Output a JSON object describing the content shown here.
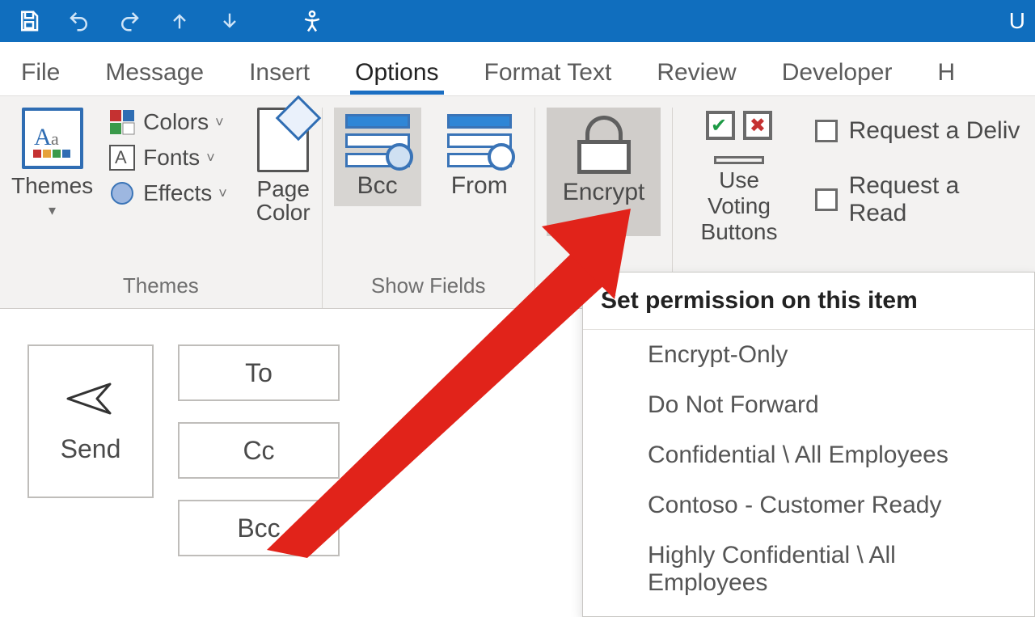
{
  "titlebar": {
    "right_text": "U"
  },
  "tabs": {
    "file": "File",
    "message": "Message",
    "insert": "Insert",
    "options": "Options",
    "format_text": "Format Text",
    "review": "Review",
    "developer": "Developer",
    "help": "H"
  },
  "ribbon": {
    "themes": {
      "themes_btn": "Themes",
      "colors": "Colors",
      "fonts": "Fonts",
      "effects": "Effects",
      "page_color": "Page\nColor",
      "group_label": "Themes"
    },
    "show_fields": {
      "bcc": "Bcc",
      "from": "From",
      "group_label": "Show Fields"
    },
    "encrypt": {
      "label": "Encrypt"
    },
    "tracking": {
      "voting": "Use Voting\nButtons",
      "req_delivery": "Request a Deliv",
      "req_read": "Request a Read"
    }
  },
  "compose": {
    "send": "Send",
    "to": "To",
    "cc": "Cc",
    "bcc": "Bcc"
  },
  "dropdown": {
    "header": "Set permission on this item",
    "items": [
      "Encrypt-Only",
      "Do Not Forward",
      "Confidential \\ All Employees",
      "Contoso - Customer Ready",
      "Highly Confidential \\ All Employees"
    ]
  }
}
